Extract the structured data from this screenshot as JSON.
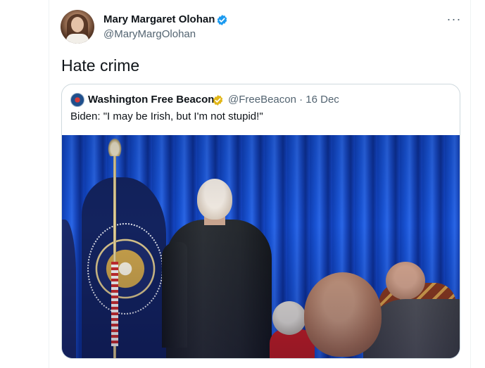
{
  "tweet": {
    "display_name": "Mary Margaret Olohan",
    "handle": "@MaryMargOlohan",
    "more_label": "···",
    "text": "Hate crime",
    "verified_color": "#1d9bf0"
  },
  "quote": {
    "display_name": "Washington Free Beacon",
    "meta": "@FreeBeacon · 16 Dec",
    "text": "Biden: \"I may be Irish, but I'm not stupid!\"",
    "verified_color": "#e2b719"
  },
  "colors": {
    "text_primary": "#0f1419",
    "text_secondary": "#536471",
    "border": "#cfd9de"
  }
}
